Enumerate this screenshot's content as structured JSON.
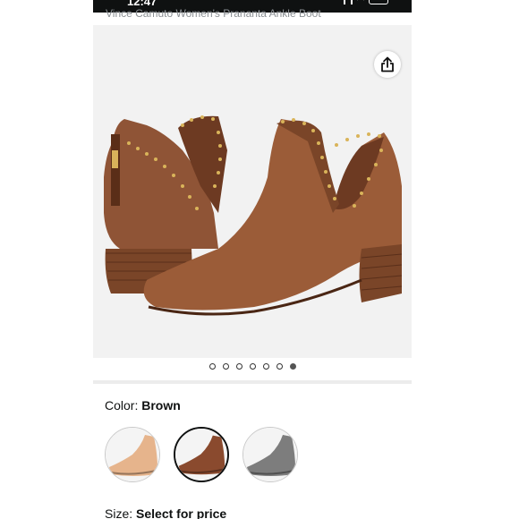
{
  "status": {
    "time": "12:47"
  },
  "product": {
    "title": "Vince Camuto Women's Prananta Ankle Boot"
  },
  "gallery": {
    "image_count": 7,
    "active_index": 7
  },
  "color": {
    "label": "Color: ",
    "value": "Brown",
    "swatch_colors": [
      "#e6b48c",
      "#8a4a2e",
      "#7d7d7d"
    ],
    "selected_index": 2
  },
  "size": {
    "label": "Size: ",
    "value": "Select for price"
  }
}
